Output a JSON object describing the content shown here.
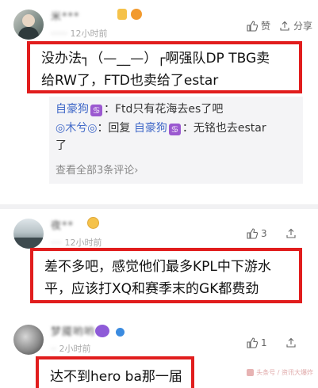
{
  "comment1": {
    "username": "米***",
    "time": "12小时前",
    "like_label": "赞",
    "share_label": "分享",
    "text_line1": "没办法┐（—__—）┌啊强队DP TBG卖",
    "text_line2": "给RW了，FTD也卖给了estar",
    "replies": {
      "r1_user": "自豪狗",
      "r1_text": "：Ftd只有花海去es了吧",
      "r2_user": "◎木兮◎",
      "r2_mid": "：回复",
      "r2_target": "自豪狗",
      "r2_text": "：无铭也去estar",
      "r2_wrap": "了",
      "view_all": "查看全部3条评论",
      "view_all_arrow": "›"
    }
  },
  "comment2": {
    "username": "夜**",
    "time": "12小时前",
    "like_count": "3",
    "text_line1": "差不多吧，感觉他们最多KPL中下游水",
    "text_line2": "平，应该打XQ和赛季末的GK都费劲"
  },
  "comment3": {
    "username": "梦魇哟哟",
    "time": "2小时前",
    "like_count": "1",
    "text_line1": "达不到hero ba那一届"
  },
  "watermark": "头条号 / 资讯大爆炸"
}
